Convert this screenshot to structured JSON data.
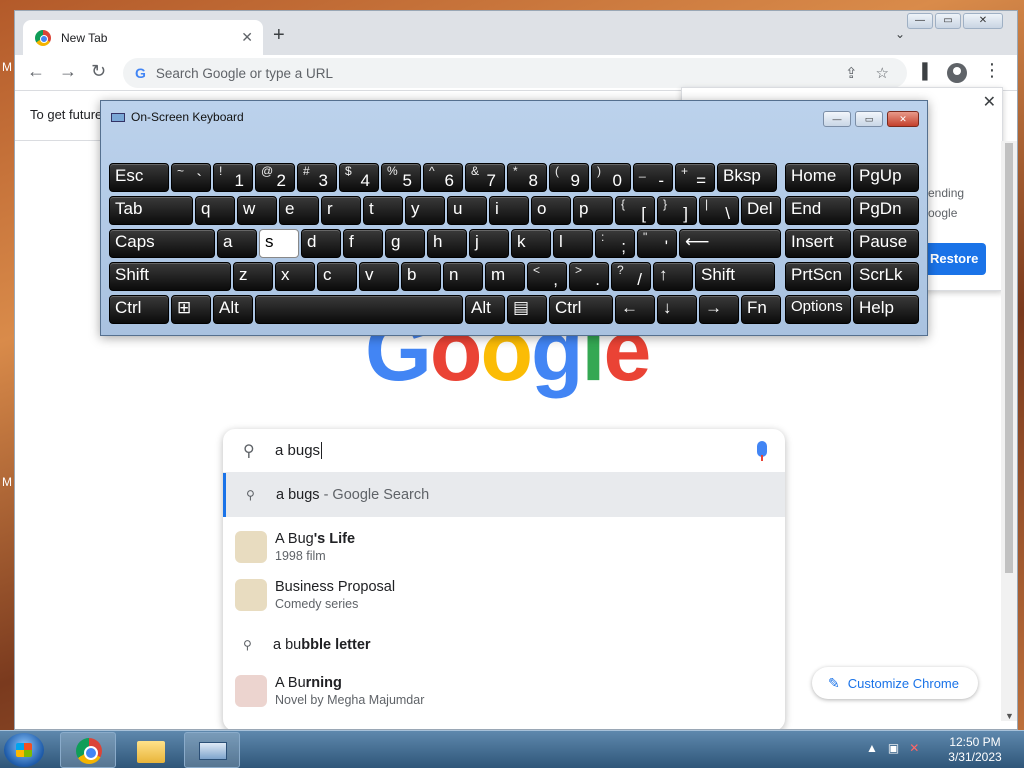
{
  "desktop": {
    "letters": [
      "M",
      "M"
    ]
  },
  "browser": {
    "tab_title": "New Tab",
    "tab_close": "✕",
    "new_tab": "+",
    "tab_search": "⌄",
    "window_buttons": {
      "minimize": "—",
      "maximize": "▭",
      "close": "✕"
    },
    "back": "←",
    "forward": "→",
    "reload": "↻",
    "omnibox_g": "G",
    "omnibox_placeholder": "Search Google or type a URL",
    "share_icon": "⇪",
    "star_icon": "☆",
    "sidepanel_icon": "▐",
    "menu_icon": "⋮",
    "infobar_text": "To get future",
    "restore_popup": {
      "close": "✕",
      "text1": "ending",
      "text2": "oogle",
      "button": "Restore"
    }
  },
  "google_logo": {
    "letters": [
      "G",
      "o",
      "o",
      "g",
      "l",
      "e"
    ],
    "colors": [
      "#4285f4",
      "#ea4335",
      "#fbbc05",
      "#4285f4",
      "#34a853",
      "#ea4335"
    ]
  },
  "search": {
    "value": "a bugs",
    "suggestions": [
      {
        "prefix": "a bugs",
        "suffix": " - Google Search",
        "type": "search"
      },
      {
        "title_plain": "A Bug",
        "title_bold": "'s Life",
        "subtitle": "1998 film",
        "thumb": "#e8dcc0"
      },
      {
        "title_plain": "",
        "title_bold": "Business Proposal",
        "subtitle": "Comedy series",
        "thumb": "#e8dcc0"
      },
      {
        "prefix": "a bu",
        "bold": "bble letter",
        "type": "search"
      },
      {
        "title_plain": "A Bu",
        "title_bold": "rning",
        "subtitle": "Novel by Megha Majumdar",
        "thumb": "#ecd4cf"
      }
    ]
  },
  "customize": {
    "label": "Customize Chrome",
    "icon": "✎"
  },
  "osk": {
    "title": "On-Screen Keyboard",
    "buttons": {
      "minimize": "—",
      "restore": "▭",
      "close": "✕"
    },
    "rows": [
      [
        {
          "l": "Esc"
        },
        {
          "u": "~",
          "d": "`"
        },
        {
          "u": "!",
          "d": "1"
        },
        {
          "u": "@",
          "d": "2"
        },
        {
          "u": "#",
          "d": "3"
        },
        {
          "u": "$",
          "d": "4"
        },
        {
          "u": "%",
          "d": "5"
        },
        {
          "u": "^",
          "d": "6"
        },
        {
          "u": "&",
          "d": "7"
        },
        {
          "u": "*",
          "d": "8"
        },
        {
          "u": "(",
          "d": "9"
        },
        {
          "u": ")",
          "d": "0"
        },
        {
          "u": "_",
          "d": "-"
        },
        {
          "u": "+",
          "d": "="
        },
        {
          "l": "Bksp"
        },
        {
          "l": "Home"
        },
        {
          "l": "PgUp"
        }
      ],
      [
        {
          "l": "Tab"
        },
        {
          "l": "q"
        },
        {
          "l": "w"
        },
        {
          "l": "e"
        },
        {
          "l": "r"
        },
        {
          "l": "t"
        },
        {
          "l": "y"
        },
        {
          "l": "u"
        },
        {
          "l": "i"
        },
        {
          "l": "o"
        },
        {
          "l": "p"
        },
        {
          "u": "{",
          "d": "["
        },
        {
          "u": "}",
          "d": "]"
        },
        {
          "u": "|",
          "d": "\\"
        },
        {
          "l": "Del"
        },
        {
          "l": "End"
        },
        {
          "l": "PgDn"
        }
      ],
      [
        {
          "l": "Caps"
        },
        {
          "l": "a"
        },
        {
          "l": "s"
        },
        {
          "l": "d"
        },
        {
          "l": "f"
        },
        {
          "l": "g"
        },
        {
          "l": "h"
        },
        {
          "l": "j"
        },
        {
          "l": "k"
        },
        {
          "l": "l"
        },
        {
          "u": ":",
          "d": ";"
        },
        {
          "u": "\"",
          "d": "'"
        },
        {
          "l": "⟵"
        },
        {
          "l": "Insert"
        },
        {
          "l": "Pause"
        }
      ],
      [
        {
          "l": "Shift"
        },
        {
          "l": "z"
        },
        {
          "l": "x"
        },
        {
          "l": "c"
        },
        {
          "l": "v"
        },
        {
          "l": "b"
        },
        {
          "l": "n"
        },
        {
          "l": "m"
        },
        {
          "u": "<",
          "d": ","
        },
        {
          "u": ">",
          "d": "."
        },
        {
          "u": "?",
          "d": "/"
        },
        {
          "l": "↑"
        },
        {
          "l": "Shift"
        },
        {
          "l": "PrtScn"
        },
        {
          "l": "ScrLk"
        }
      ],
      [
        {
          "l": "Ctrl"
        },
        {
          "l": "⊞"
        },
        {
          "l": "Alt"
        },
        {
          "l": ""
        },
        {
          "l": "Alt"
        },
        {
          "l": "▤"
        },
        {
          "l": "Ctrl"
        },
        {
          "l": "←"
        },
        {
          "l": "↓"
        },
        {
          "l": "→"
        },
        {
          "l": "Fn"
        },
        {
          "l": "Options"
        },
        {
          "l": "Help"
        }
      ]
    ]
  },
  "taskbar": {
    "time": "12:50 PM",
    "date": "3/31/2023"
  }
}
